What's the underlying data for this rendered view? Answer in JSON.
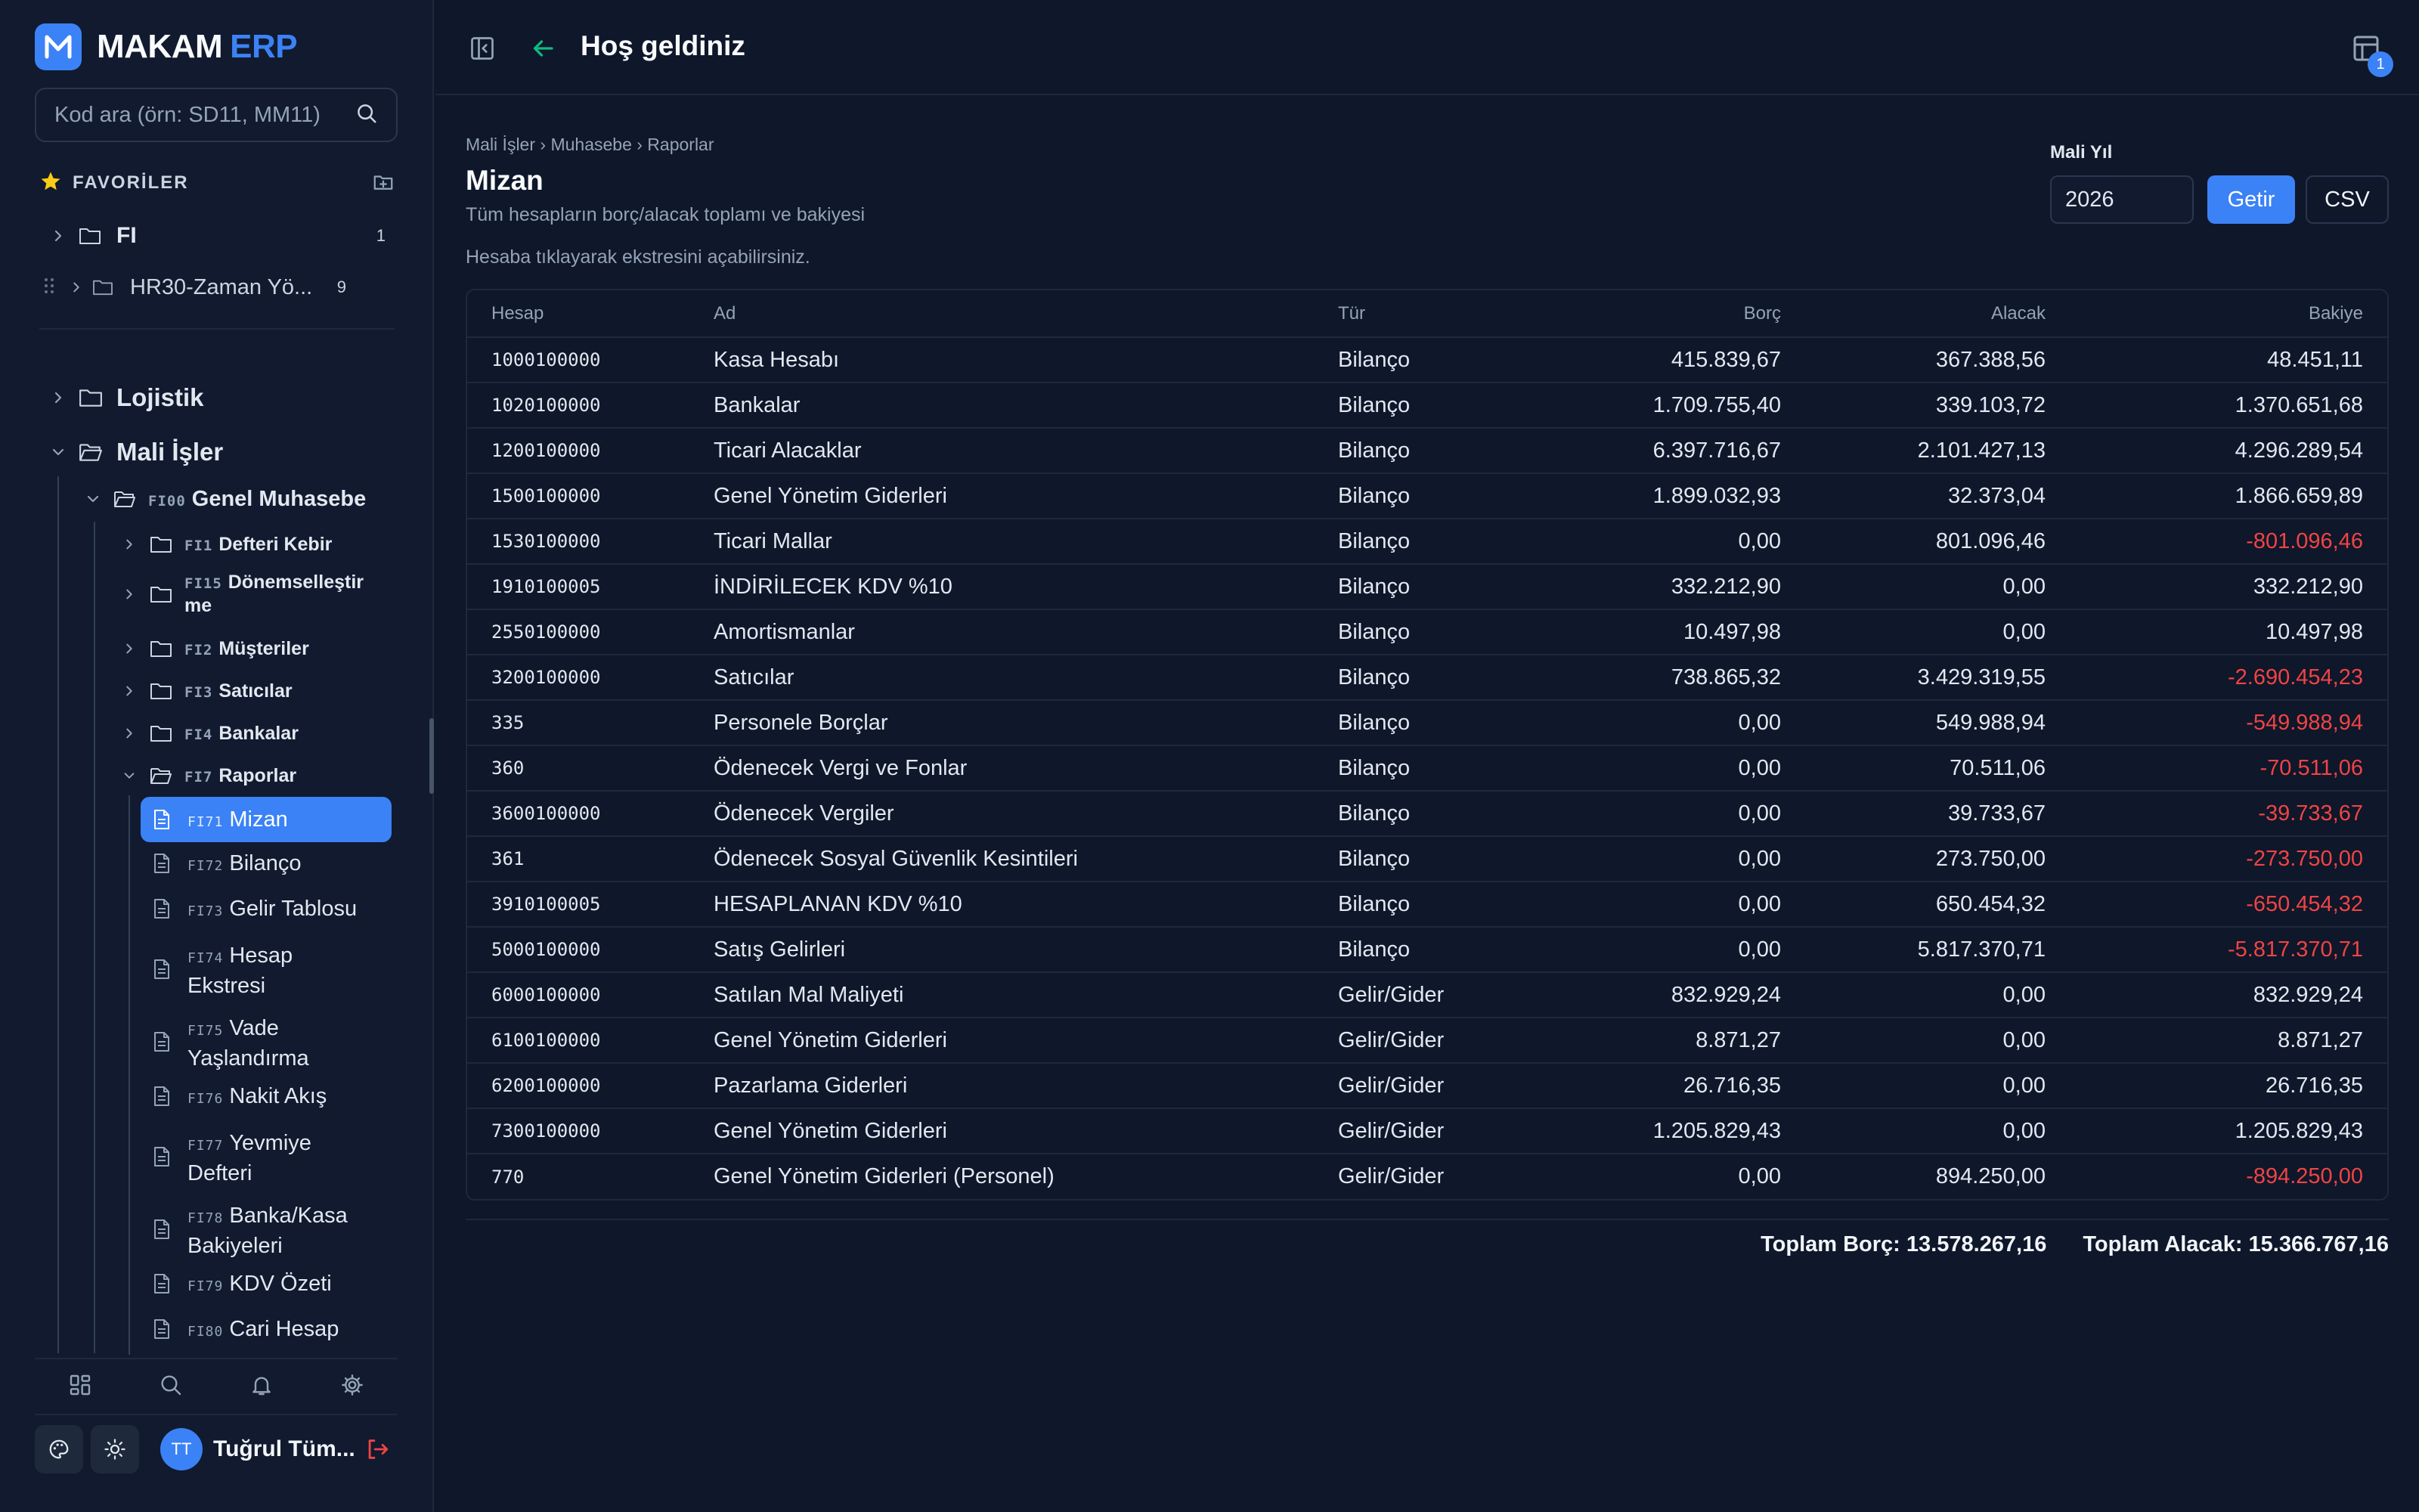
{
  "app": {
    "brand": "MAKAM",
    "brand_suffix": "ERP",
    "page_header": "Hoş geldiniz",
    "notification_count": "1"
  },
  "sidebar": {
    "search_placeholder": "Kod ara (örn: SD11, MM11)",
    "favorites_title": "FAVORİLER",
    "favorites": [
      {
        "label": "FI",
        "count": "1"
      },
      {
        "label": "HR30-Zaman Yö...",
        "count": "9"
      }
    ],
    "modules": [
      {
        "label": "Lojistik"
      },
      {
        "label": "Mali İşler"
      }
    ],
    "fi00": {
      "code": "FI00",
      "label": "Genel Muhasebe"
    },
    "fi_groups": [
      {
        "code": "FI1",
        "label": "Defteri Kebir"
      },
      {
        "code": "FI15",
        "label": "Dönemselleştir me"
      },
      {
        "code": "FI2",
        "label": "Müşteriler"
      },
      {
        "code": "FI3",
        "label": "Satıcılar"
      },
      {
        "code": "FI4",
        "label": "Bankalar"
      },
      {
        "code": "FI7",
        "label": "Raporlar"
      }
    ],
    "reports": [
      {
        "code": "FI71",
        "label": "Mizan"
      },
      {
        "code": "FI72",
        "label": "Bilanço"
      },
      {
        "code": "FI73",
        "label": "Gelir Tablosu"
      },
      {
        "code": "FI74",
        "label": "Hesap Ekstresi"
      },
      {
        "code": "FI75",
        "label": "Vade Yaşlandırma"
      },
      {
        "code": "FI76",
        "label": "Nakit Akış"
      },
      {
        "code": "FI77",
        "label": "Yevmiye Defteri"
      },
      {
        "code": "FI78",
        "label": "Banka/Kasa Bakiyeleri"
      },
      {
        "code": "FI79",
        "label": "KDV Özeti"
      },
      {
        "code": "FI80",
        "label": "Cari Hesap"
      }
    ],
    "user": {
      "initials": "TT",
      "name": "Tuğrul Tüm..."
    }
  },
  "main": {
    "breadcrumb": "Mali İşler › Muhasebe › Raporlar",
    "title": "Mizan",
    "subtitle": "Tüm hesapların borç/alacak toplamı ve bakiyesi",
    "hint": "Hesaba tıklayarak ekstresini açabilirsiniz.",
    "fiscal_year_label": "Mali Yıl",
    "fiscal_year": "2026",
    "fetch_label": "Getir",
    "csv_label": "CSV",
    "columns": [
      "Hesap",
      "Ad",
      "Tür",
      "Borç",
      "Alacak",
      "Bakiye"
    ],
    "rows": [
      [
        "1000100000",
        "Kasa Hesabı",
        "Bilanço",
        "415.839,67",
        "367.388,56",
        "48.451,11"
      ],
      [
        "1020100000",
        "Bankalar",
        "Bilanço",
        "1.709.755,40",
        "339.103,72",
        "1.370.651,68"
      ],
      [
        "1200100000",
        "Ticari Alacaklar",
        "Bilanço",
        "6.397.716,67",
        "2.101.427,13",
        "4.296.289,54"
      ],
      [
        "1500100000",
        "Genel Yönetim Giderleri",
        "Bilanço",
        "1.899.032,93",
        "32.373,04",
        "1.866.659,89"
      ],
      [
        "1530100000",
        "Ticari Mallar",
        "Bilanço",
        "0,00",
        "801.096,46",
        "-801.096,46"
      ],
      [
        "1910100005",
        "İNDİRİLECEK KDV %10",
        "Bilanço",
        "332.212,90",
        "0,00",
        "332.212,90"
      ],
      [
        "2550100000",
        "Amortismanlar",
        "Bilanço",
        "10.497,98",
        "0,00",
        "10.497,98"
      ],
      [
        "3200100000",
        "Satıcılar",
        "Bilanço",
        "738.865,32",
        "3.429.319,55",
        "-2.690.454,23"
      ],
      [
        "335",
        "Personele Borçlar",
        "Bilanço",
        "0,00",
        "549.988,94",
        "-549.988,94"
      ],
      [
        "360",
        "Ödenecek Vergi ve Fonlar",
        "Bilanço",
        "0,00",
        "70.511,06",
        "-70.511,06"
      ],
      [
        "3600100000",
        "Ödenecek Vergiler",
        "Bilanço",
        "0,00",
        "39.733,67",
        "-39.733,67"
      ],
      [
        "361",
        "Ödenecek Sosyal Güvenlik Kesintileri",
        "Bilanço",
        "0,00",
        "273.750,00",
        "-273.750,00"
      ],
      [
        "3910100005",
        "HESAPLANAN KDV %10",
        "Bilanço",
        "0,00",
        "650.454,32",
        "-650.454,32"
      ],
      [
        "5000100000",
        "Satış Gelirleri",
        "Bilanço",
        "0,00",
        "5.817.370,71",
        "-5.817.370,71"
      ],
      [
        "6000100000",
        "Satılan Mal Maliyeti",
        "Gelir/Gider",
        "832.929,24",
        "0,00",
        "832.929,24"
      ],
      [
        "6100100000",
        "Genel Yönetim Giderleri",
        "Gelir/Gider",
        "8.871,27",
        "0,00",
        "8.871,27"
      ],
      [
        "6200100000",
        "Pazarlama Giderleri",
        "Gelir/Gider",
        "26.716,35",
        "0,00",
        "26.716,35"
      ],
      [
        "7300100000",
        "Genel Yönetim Giderleri",
        "Gelir/Gider",
        "1.205.829,43",
        "0,00",
        "1.205.829,43"
      ],
      [
        "770",
        "Genel Yönetim Giderleri (Personel)",
        "Gelir/Gider",
        "0,00",
        "894.250,00",
        "-894.250,00"
      ]
    ],
    "total_debit": "Toplam Borç: 13.578.267,16",
    "total_credit": "Toplam Alacak: 15.366.767,16"
  },
  "colors": {
    "accent": "#3b82f6",
    "negative": "#ef4444",
    "back_arrow": "#10b981",
    "star": "#facc15",
    "logout": "#ef4444"
  }
}
